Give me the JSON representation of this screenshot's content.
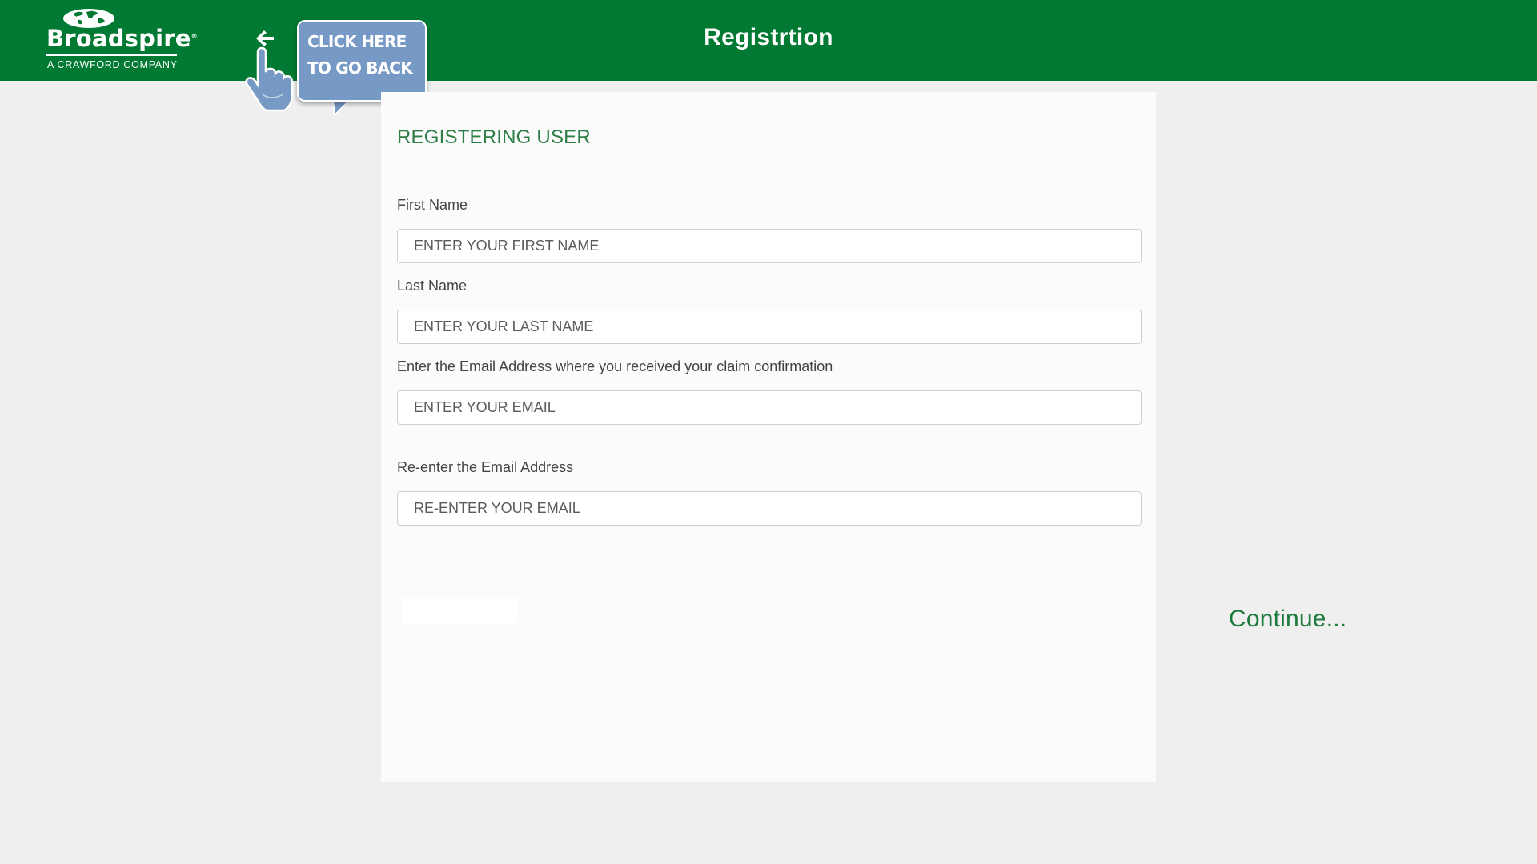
{
  "header": {
    "logo": {
      "name": "Broadspire",
      "registered_mark": "®",
      "tagline": "A CRAWFORD COMPANY"
    },
    "title": "Registrtion",
    "back": {
      "icon": "back-arrow-icon",
      "callout_text": "CLICK HERE TO GO BACK"
    }
  },
  "form": {
    "heading": "REGISTERING USER",
    "fields": [
      {
        "label": "First Name",
        "placeholder": "ENTER YOUR FIRST NAME",
        "value": ""
      },
      {
        "label": "Last Name",
        "placeholder": "ENTER YOUR LAST NAME",
        "value": ""
      },
      {
        "label": "Enter the Email Address where you received your claim confirmation",
        "placeholder": "ENTER YOUR EMAIL",
        "value": ""
      },
      {
        "label": "Re-enter the Email Address",
        "placeholder": "RE-ENTER YOUR EMAIL",
        "value": ""
      }
    ]
  },
  "continue_label": "Continue...",
  "colors": {
    "header_bg": "#007a33",
    "accent_green": "#2d7d47",
    "callout_bg": "#7799c5",
    "page_bg": "#efefef",
    "panel_bg": "#fbfbfb"
  }
}
